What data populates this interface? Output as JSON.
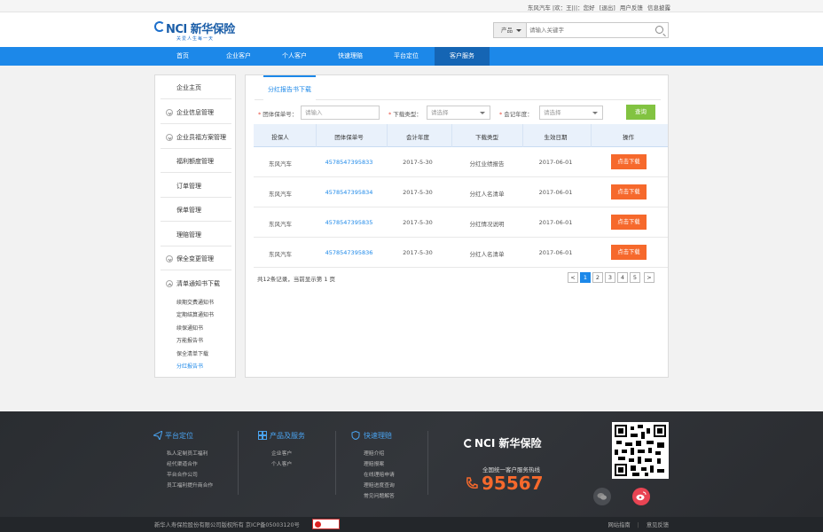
{
  "topbar": {
    "user": "东风汽车 |欢：王|||：您好",
    "logout": "[退出]",
    "feedback": "用户反馈",
    "news": "信息披露"
  },
  "header": {
    "logo_text": "NCI 新华保险",
    "logo_slogan": "关爱人生每一天",
    "search_category": "产品",
    "search_placeholder": "请输入关键字"
  },
  "nav": {
    "items": [
      "首页",
      "企业客户",
      "个人客户",
      "快速理赔",
      "平台定位",
      "客户服务"
    ],
    "active_index": 5
  },
  "sidebar": {
    "items": [
      {
        "label": "企业主页",
        "icon": ""
      },
      {
        "label": "企业信息管理",
        "icon": "expand-icon"
      },
      {
        "label": "企业员福方案管理",
        "icon": "expand-icon"
      },
      {
        "label": "福利额度管理",
        "icon": ""
      },
      {
        "label": "订单管理",
        "icon": ""
      },
      {
        "label": "保单管理",
        "icon": ""
      },
      {
        "label": "理赔管理",
        "icon": ""
      },
      {
        "label": "保全变更管理",
        "icon": "expand-icon"
      },
      {
        "label": "清单通知书下载",
        "icon": "collapse-icon"
      }
    ],
    "subitems": [
      "续期交费通知书",
      "定期结算通知书",
      "续保通知书",
      "万能报告书",
      "保全清单下载",
      "分红报告书"
    ],
    "active_sub_index": 5
  },
  "main": {
    "tab": "分红报告书下载",
    "form": {
      "policy_label": "团体保单号：",
      "policy_placeholder": "请输入",
      "type_label": "下载类型：",
      "type_value": "请选择",
      "year_label": "会记年度：",
      "year_value": "请选择",
      "query_button": "查询"
    },
    "table": {
      "headers": [
        "投保人",
        "团体保单号",
        "会计年度",
        "下载类型",
        "生效日期",
        "操作"
      ],
      "rows": [
        {
          "holder": "东风汽车",
          "policy": "4578547395833",
          "year": "2017-5-30",
          "type": "分红业绩报告",
          "date": "2017-06-01",
          "action": "点击下载"
        },
        {
          "holder": "东风汽车",
          "policy": "4578547395834",
          "year": "2017-5-30",
          "type": "分红人名清单",
          "date": "2017-06-01",
          "action": "点击下载"
        },
        {
          "holder": "东风汽车",
          "policy": "4578547395835",
          "year": "2017-5-30",
          "type": "分红情况说明",
          "date": "2017-06-01",
          "action": "点击下载"
        },
        {
          "holder": "东风汽车",
          "policy": "4578547395836",
          "year": "2017-5-30",
          "type": "分红人名清单",
          "date": "2017-06-01",
          "action": "点击下载"
        }
      ]
    },
    "summary": "共12条记录，当前显示第 1 页",
    "pager": {
      "prev": "<",
      "pages": [
        "1",
        "2",
        "3",
        "4",
        "5"
      ],
      "next": ">",
      "current": 0
    }
  },
  "footer": {
    "col1": {
      "title": "平台定位",
      "links": [
        "私人定制员工福利",
        "经代渠道合作",
        "平台合作公司",
        "员工福利提升商合作"
      ]
    },
    "col2": {
      "title": "产品及服务",
      "links": [
        "企业客户",
        "个人客户"
      ]
    },
    "col3": {
      "title": "快速理赔",
      "links": [
        "理赔介绍",
        "理赔报案",
        "在线理赔申请",
        "理赔进度查询",
        "常见问题解答"
      ]
    },
    "logo": "NCI 新华保险",
    "hotline_label": "全国统一客户服务热线",
    "hotline": "95567"
  },
  "bottom": {
    "copyright": "新华人寿保险股份有限公司版权所有 京ICP备05003120号",
    "links": [
      "网站指南",
      "意见反馈"
    ]
  },
  "colors": {
    "primary": "#1c88e9",
    "nav_active": "#1565b4",
    "download": "#f6692c",
    "query": "#82c341",
    "footer": "#2d3034"
  }
}
